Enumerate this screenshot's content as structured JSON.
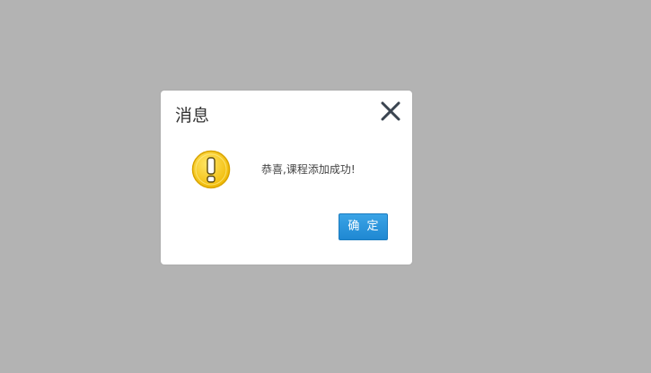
{
  "dialog": {
    "title": "消息",
    "message": "恭喜,课程添加成功!",
    "ok_label": "确 定",
    "icons": {
      "close": "close-icon",
      "status": "warning-icon"
    }
  },
  "colors": {
    "overlay": "#b3b3b3",
    "dialog_background": "#ffffff",
    "warning_fill": "#f5c518",
    "button_blue": "#1f88d2"
  }
}
